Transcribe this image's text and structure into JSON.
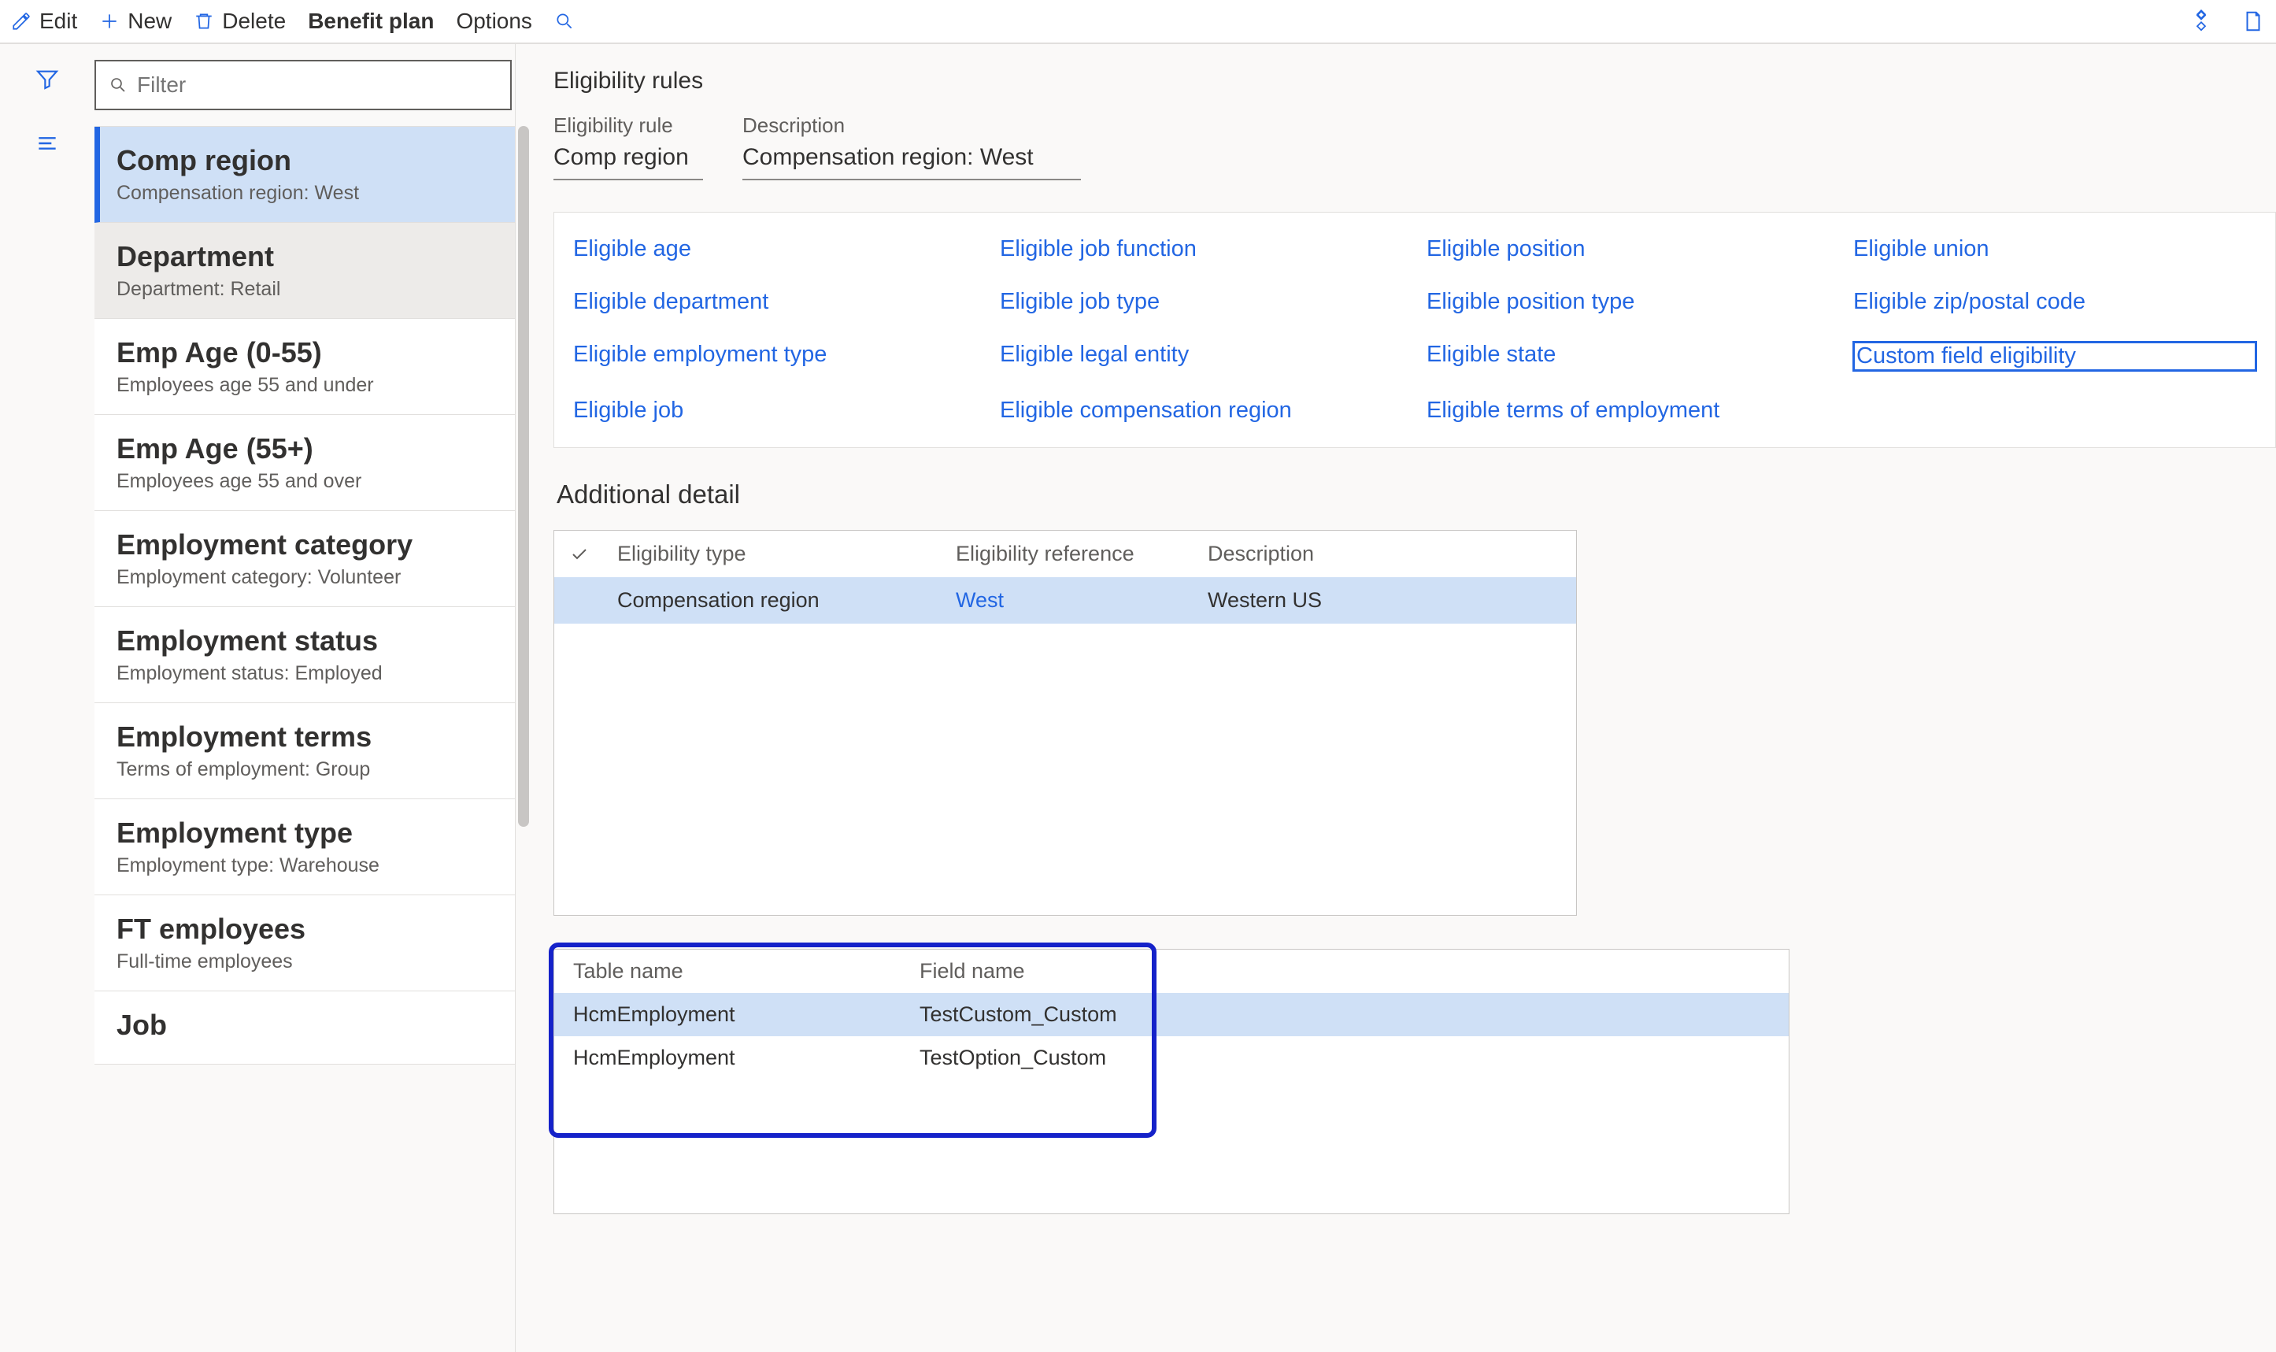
{
  "toolbar": {
    "edit": "Edit",
    "new": "New",
    "delete": "Delete",
    "benefit_plan": "Benefit plan",
    "options": "Options"
  },
  "filter": {
    "placeholder": "Filter"
  },
  "rules": [
    {
      "title": "Comp region",
      "sub": "Compensation region:  West",
      "selected": true
    },
    {
      "title": "Department",
      "sub": "Department:  Retail",
      "hover": true
    },
    {
      "title": "Emp Age (0-55)",
      "sub": "Employees age 55 and under"
    },
    {
      "title": "Emp Age (55+)",
      "sub": "Employees age 55 and over"
    },
    {
      "title": "Employment category",
      "sub": "Employment category:  Volunteer"
    },
    {
      "title": "Employment status",
      "sub": "Employment status: Employed"
    },
    {
      "title": "Employment terms",
      "sub": "Terms of employment: Group"
    },
    {
      "title": "Employment type",
      "sub": "Employment type: Warehouse"
    },
    {
      "title": "FT employees",
      "sub": "Full-time employees"
    },
    {
      "title": "Job",
      "sub": ""
    }
  ],
  "header": {
    "section": "Eligibility rules",
    "rule_label": "Eligibility rule",
    "rule_value": "Comp region",
    "desc_label": "Description",
    "desc_value": "Compensation region:  West"
  },
  "links": [
    "Eligible age",
    "Eligible job function",
    "Eligible position",
    "Eligible union",
    "Eligible department",
    "Eligible job type",
    "Eligible position type",
    "Eligible zip/postal code",
    "Eligible employment type",
    "Eligible legal entity",
    "Eligible state",
    "Custom field eligibility",
    "Eligible job",
    "Eligible compensation region",
    "Eligible terms of employment"
  ],
  "links_focused_index": 11,
  "additional_title": "Additional detail",
  "grid1": {
    "headers": [
      "Eligibility type",
      "Eligibility reference",
      "Description"
    ],
    "row": {
      "type": "Compensation region",
      "ref": "West",
      "desc": "Western US"
    }
  },
  "grid2": {
    "headers": [
      "Table name",
      "Field name"
    ],
    "rows": [
      {
        "table": "HcmEmployment",
        "field": "TestCustom_Custom",
        "selected": true
      },
      {
        "table": "HcmEmployment",
        "field": "TestOption_Custom"
      }
    ]
  }
}
